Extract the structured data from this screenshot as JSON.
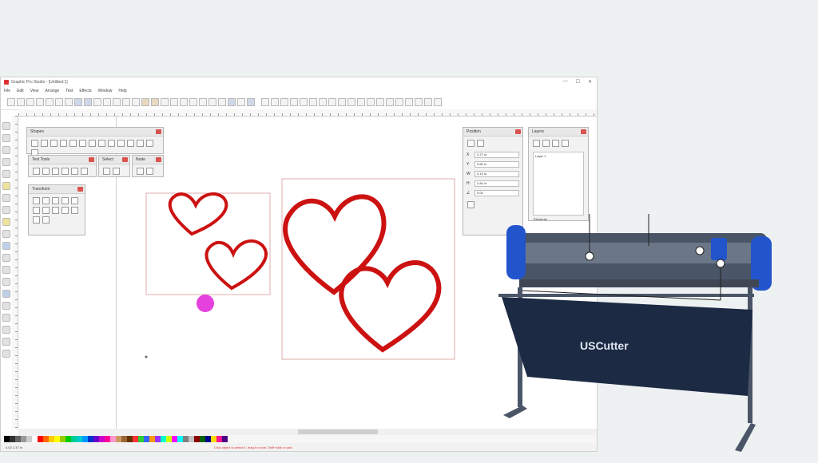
{
  "app": {
    "title": "Graphic Pro Studio - [Untitled:1]",
    "window_controls": [
      "—",
      "☐",
      "✕"
    ],
    "menu": [
      "File",
      "Edit",
      "View",
      "Arrange",
      "Text",
      "Effects",
      "Window",
      "Help"
    ]
  },
  "panels": {
    "shapes": {
      "title": "Shapes"
    },
    "text_tools": {
      "title": "Text Tools"
    },
    "select": {
      "title": "Select"
    },
    "node": {
      "title": "Node"
    },
    "transform": {
      "title": "Transform"
    },
    "position": {
      "title": "Position",
      "fields": [
        {
          "label": "X",
          "value": "4.72 in"
        },
        {
          "label": "Y",
          "value": "3.65 in"
        },
        {
          "label": "W",
          "value": "3.19 in"
        },
        {
          "label": "H",
          "value": "2.84 in"
        },
        {
          "label": "∠",
          "value": "0.00"
        }
      ]
    },
    "layers": {
      "title": "Layers",
      "item": "Layer 1",
      "footer": "Elements"
    }
  },
  "status": {
    "coords": "4.02  1.37 in",
    "message": "Click object to select it, drag to move, Shift+click to add"
  },
  "palette": [
    "#000000",
    "#333333",
    "#666666",
    "#999999",
    "#cccccc",
    "#ffffff",
    "#ff0000",
    "#ff6600",
    "#ffcc00",
    "#ffff00",
    "#99cc00",
    "#00cc00",
    "#00cc99",
    "#00cccc",
    "#0099ff",
    "#0033cc",
    "#6600cc",
    "#cc00cc",
    "#ff0099",
    "#ff99cc",
    "#cc9966",
    "#996633",
    "#663300",
    "#ff3333",
    "#33cc33",
    "#3366ff",
    "#ff9900",
    "#9933ff",
    "#00ffcc",
    "#ccff00",
    "#ff00ff",
    "#00ffff",
    "#808080",
    "#c0c0c0",
    "#8b0000",
    "#006400",
    "#00008b",
    "#ffd700",
    "#ff1493",
    "#4b0082"
  ],
  "plotter": {
    "brand": "USCutter"
  },
  "colors": {
    "heart": "#cc1111",
    "plotter_blue": "#2255cc",
    "plotter_frame": "#4a5568",
    "basket": "#1c2a44"
  }
}
